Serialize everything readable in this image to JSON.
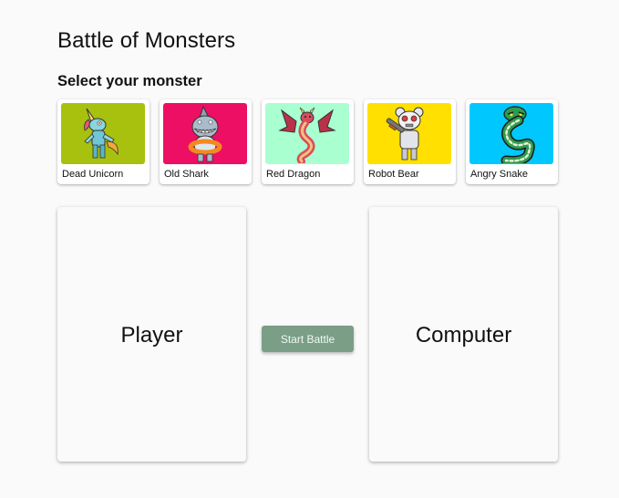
{
  "app": {
    "title": "Battle of Monsters",
    "select_label": "Select your monster"
  },
  "monsters": [
    {
      "name": "Dead Unicorn",
      "bg_color": "#a8c10f",
      "icon": "unicorn-icon"
    },
    {
      "name": "Old Shark",
      "bg_color": "#ec0f63",
      "icon": "shark-icon"
    },
    {
      "name": "Red Dragon",
      "bg_color": "#a9ffd0",
      "icon": "dragon-icon"
    },
    {
      "name": "Robot Bear",
      "bg_color": "#ffe000",
      "icon": "robot-bear-icon"
    },
    {
      "name": "Angry Snake",
      "bg_color": "#00c8ff",
      "icon": "snake-icon"
    }
  ],
  "battle": {
    "player_label": "Player",
    "computer_label": "Computer",
    "start_button_label": "Start Battle",
    "start_button_color": "#7a9f86"
  }
}
